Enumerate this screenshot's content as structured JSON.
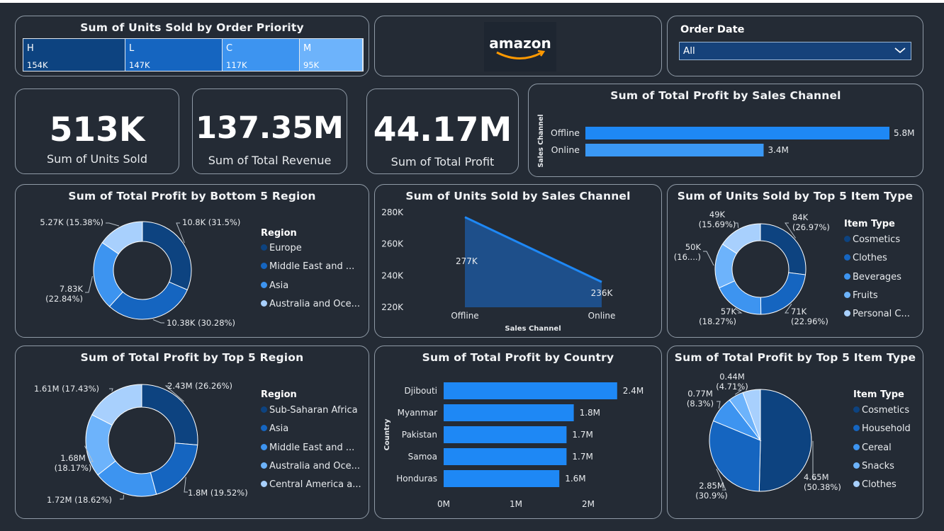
{
  "treemap": {
    "title": "Sum of Units Sold by Order Priority",
    "cells": [
      {
        "label": "H",
        "value": "154K",
        "num": 154,
        "color": "#0d4380"
      },
      {
        "label": "L",
        "value": "147K",
        "num": 147,
        "color": "#1565c0"
      },
      {
        "label": "C",
        "value": "117K",
        "num": 117,
        "color": "#3d94f0"
      },
      {
        "label": "M",
        "value": "95K",
        "num": 95,
        "color": "#6db3fb"
      }
    ]
  },
  "logo": {
    "text": "amazon"
  },
  "slicer": {
    "label": "Order Date",
    "value": "All"
  },
  "kpis": [
    {
      "value": "513K",
      "label": "Sum of Units Sold"
    },
    {
      "value": "137.35M",
      "label": "Sum of Total Revenue"
    },
    {
      "value": "44.17M",
      "label": "Sum of Total Profit"
    }
  ],
  "colors": {
    "background": "#242b35",
    "bar": "#1e88f5",
    "dark_blue": "#0d4380",
    "mid_blue": "#1565c0",
    "light_blue": "#3d94f0",
    "pale_blue": "#6db3fb",
    "paler_blue": "#a8d0fd",
    "border": "#8f9aa6"
  },
  "chart_data": [
    {
      "id": "profit_by_sales_channel",
      "type": "bar",
      "orientation": "horizontal",
      "title": "Sum of Total Profit by Sales Channel",
      "ylabel": "Sales Channel",
      "categories": [
        "Offline",
        "Online"
      ],
      "values": [
        5.8,
        3.4
      ],
      "data_labels": [
        "5.8M",
        "3.4M"
      ],
      "xlim": [
        0,
        5.8
      ]
    },
    {
      "id": "profit_bottom5_region",
      "type": "pie",
      "donut": true,
      "title": "Sum of Total Profit by Bottom 5 Region",
      "legend_title": "Region",
      "legend": [
        "Europe",
        "Middle East and ...",
        "Asia",
        "Australia and Oce..."
      ],
      "slices": [
        {
          "value": 10.8,
          "label": "10.8K (31.5%)",
          "color": "#0d4380"
        },
        {
          "value": 10.38,
          "label": "10.38K (30.28%)",
          "color": "#1565c0"
        },
        {
          "value": 7.83,
          "label": "7.83K\n(22.84%)",
          "color": "#3d94f0"
        },
        {
          "value": 5.27,
          "label": "5.27K (15.38%)",
          "color": "#a8d0fd"
        }
      ]
    },
    {
      "id": "units_by_sales_channel",
      "type": "area",
      "title": "Sum of Units Sold by Sales Channel",
      "xlabel": "Sales Channel",
      "categories": [
        "Offline",
        "Online"
      ],
      "values": [
        277,
        236
      ],
      "data_labels": [
        "277K",
        "236K"
      ],
      "ylim": [
        220,
        280
      ],
      "yticks": [
        "280K",
        "260K",
        "240K",
        "220K"
      ]
    },
    {
      "id": "units_top5_item",
      "type": "pie",
      "donut": true,
      "title": "Sum of Units Sold by Top 5 Item Type",
      "legend_title": "Item Type",
      "legend": [
        "Cosmetics",
        "Clothes",
        "Beverages",
        "Fruits",
        "Personal C..."
      ],
      "slices": [
        {
          "value": 84,
          "label": "84K\n(26.97%)",
          "color": "#0d4380"
        },
        {
          "value": 71,
          "label": "71K\n(22.96%)",
          "color": "#1565c0"
        },
        {
          "value": 57,
          "label": "57K\n(18.27%)",
          "color": "#3d94f0"
        },
        {
          "value": 50,
          "label": "50K\n(16....)",
          "color": "#6db3fb"
        },
        {
          "value": 49,
          "label": "49K\n(15.69%)",
          "color": "#a8d0fd"
        }
      ]
    },
    {
      "id": "profit_top5_region",
      "type": "pie",
      "donut": true,
      "title": "Sum of Total Profit by Top 5 Region",
      "legend_title": "Region",
      "legend": [
        "Sub-Saharan Africa",
        "Asia",
        "Middle East and ...",
        "Australia and Oce...",
        "Central America a..."
      ],
      "slices": [
        {
          "value": 2.43,
          "label": "2.43M (26.26%)",
          "color": "#0d4380"
        },
        {
          "value": 1.8,
          "label": "1.8M (19.52%)",
          "color": "#1565c0"
        },
        {
          "value": 1.72,
          "label": "1.72M (18.62%)",
          "color": "#3d94f0"
        },
        {
          "value": 1.68,
          "label": "1.68M\n(18.17%)",
          "color": "#6db3fb"
        },
        {
          "value": 1.61,
          "label": "1.61M (17.43%)",
          "color": "#a8d0fd"
        }
      ]
    },
    {
      "id": "profit_by_country",
      "type": "bar",
      "orientation": "horizontal",
      "title": "Sum of Total Profit by Country",
      "ylabel": "Country",
      "categories": [
        "Djibouti",
        "Myanmar",
        "Pakistan",
        "Samoa",
        "Honduras"
      ],
      "values": [
        2.4,
        1.8,
        1.7,
        1.7,
        1.6
      ],
      "data_labels": [
        "2.4M",
        "1.8M",
        "1.7M",
        "1.7M",
        "1.6M"
      ],
      "xticks": [
        "0M",
        "1M",
        "2M"
      ],
      "xlim": [
        0,
        2.4
      ]
    },
    {
      "id": "profit_top5_item",
      "type": "pie",
      "title": "Sum of Total Profit by Top 5 Item Type",
      "legend_title": "Item Type",
      "legend": [
        "Cosmetics",
        "Household",
        "Cereal",
        "Snacks",
        "Clothes"
      ],
      "slices": [
        {
          "value": 4.65,
          "label": "4.65M\n(50.38%)",
          "color": "#0d4380"
        },
        {
          "value": 2.85,
          "label": "2.85M\n(30.9%)",
          "color": "#1565c0"
        },
        {
          "value": 0.77,
          "label": "0.77M\n(8.3%)",
          "color": "#3d94f0"
        },
        {
          "value": 0.44,
          "label": "0.44M\n(4.71%)",
          "color": "#6db3fb"
        },
        {
          "value": 0.52,
          "label": "",
          "color": "#a8d0fd"
        }
      ]
    }
  ]
}
